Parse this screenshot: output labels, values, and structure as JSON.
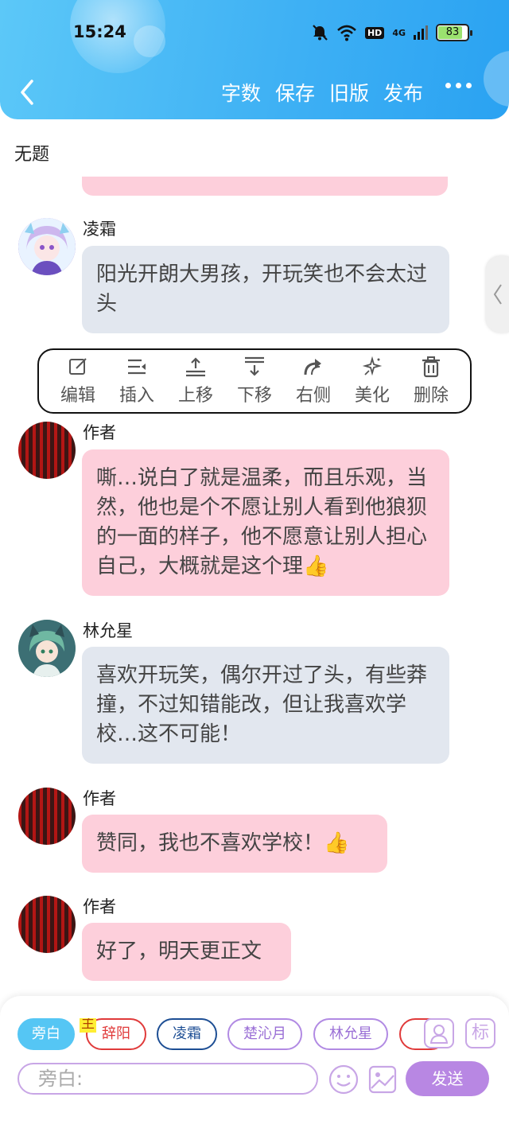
{
  "status_bar": {
    "time": "15:24",
    "battery": "83",
    "battery_level": 0.83,
    "network": "4G",
    "hd": "HD"
  },
  "header": {
    "actions": [
      "字数",
      "保存",
      "旧版",
      "发布"
    ]
  },
  "document": {
    "title": "无题"
  },
  "messages": [
    {
      "sender": "凌霜",
      "text": "阳光开朗大男孩，开玩笑也不会太过头",
      "style": "gray",
      "avatar": "anime-girl-avatar"
    },
    {
      "sender": "作者",
      "text": "嘶…说白了就是温柔，而且乐观，当然，他也是个不愿让别人看到他狼狈的一面的样子，他不愿意让别人担心自己，大概就是这个理👍",
      "style": "pink",
      "avatar": "red-lanterns-avatar"
    },
    {
      "sender": "林允星",
      "text": "喜欢开玩笑，偶尔开过了头，有些莽撞，不过知错能改，但让我喜欢学校…这不可能！",
      "style": "gray",
      "avatar": "anime-boy-avatar"
    },
    {
      "sender": "作者",
      "text": "赞同，我也不喜欢学校！👍",
      "style": "pink",
      "avatar": "red-lanterns-avatar"
    },
    {
      "sender": "作者",
      "text": "好了，明天更正文",
      "style": "pink",
      "avatar": "red-lanterns-avatar"
    }
  ],
  "toolbar": {
    "items": [
      {
        "label": "编辑",
        "icon": "edit-icon"
      },
      {
        "label": "插入",
        "icon": "insert-icon"
      },
      {
        "label": "上移",
        "icon": "move-up-icon"
      },
      {
        "label": "下移",
        "icon": "move-down-icon"
      },
      {
        "label": "右侧",
        "icon": "redo-arrow-icon"
      },
      {
        "label": "美化",
        "icon": "sparkle-icon"
      },
      {
        "label": "删除",
        "icon": "trash-icon"
      }
    ]
  },
  "bottom": {
    "chips": [
      "旁白",
      "辞阳",
      "凌霜",
      "楚沁月",
      "林允星"
    ],
    "main_tag": "主",
    "tag_button": "标",
    "input_placeholder": "旁白:",
    "send_label": "发送"
  },
  "colors": {
    "header_gradient_start": "#5cc8f8",
    "header_gradient_end": "#2aa2f2",
    "bubble_gray": "#e2e7ef",
    "bubble_pink": "#fdcfdb",
    "accent_purple": "#b887e3",
    "chip_blue": "#55c6f4",
    "chip_red": "#e03a3a",
    "chip_navy": "#1d4e94"
  }
}
